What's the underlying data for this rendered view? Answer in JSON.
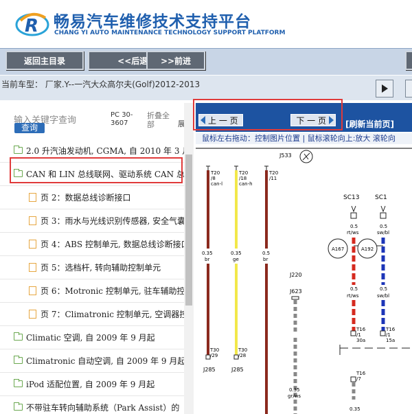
{
  "header": {
    "title_cn": "畅易汽车维修技术支持平台",
    "title_en": "CHANG YI AUTO MAINTENANCE TECHNOLOGY SUPPORT PLATFORM"
  },
  "toolbar": {
    "home_label": "返回主目录",
    "back_label": "<<后退.",
    "forward_label": ">>前进"
  },
  "car_info": "当前车型： 厂家.Y--一汽大众高尔夫(Golf)2012-2013",
  "left_panel": {
    "search_placeholder": "输入关键字查询",
    "search_button": "查询",
    "pc_label": "PC 30-",
    "pc_value": "3607",
    "fold_label_1": "折叠全",
    "fold_label_2": "部",
    "fold_label_3": "展",
    "tree": [
      {
        "type": "folder",
        "label": "2.0 升汽油发动机, CGMA, 自 2010 年 3 月"
      },
      {
        "type": "folder",
        "label": "CAN 和 LIN 总线联网、驱动系统 CAN 总线"
      },
      {
        "type": "page",
        "label": "页 2：数据总线诊断接口"
      },
      {
        "type": "page",
        "label": "页 3：雨水与光线识别传感器, 安全气囊"
      },
      {
        "type": "page",
        "label": "页 4：ABS 控制单元, 数据总线诊断接口"
      },
      {
        "type": "page",
        "label": "页 5：选档杆, 转向辅助控制单元"
      },
      {
        "type": "page",
        "label": "页 6：Motronic 控制单元, 驻车辅助控制"
      },
      {
        "type": "page",
        "label": "页 7：Climatronic 控制单元, 空调器控制"
      },
      {
        "type": "folder",
        "label": "Climatic 空调, 自 2009 年 9 月起"
      },
      {
        "type": "folder",
        "label": "Climatronic 自动空调, 自 2009 年 9 月起"
      },
      {
        "type": "folder",
        "label": "iPod 适配位置, 自 2009 年 9 月起"
      },
      {
        "type": "folder",
        "label": "不带驻车转向辅助系统（Park Assist）的"
      }
    ]
  },
  "viewer": {
    "prev_page": "上 一 页",
    "next_page": "下 一 页",
    "refresh": "[刷新当前页]",
    "hint": "鼠标左右拖动：控制图片位置 | 鼠标滚轮向上:放大  滚轮向"
  },
  "diagram": {
    "labels": {
      "j533": "J533",
      "t20_1": "T20",
      "t20_1b": "/8",
      "t20_1c": "can-l",
      "t20_2": "T20",
      "t20_2b": "/18",
      "t20_2c": "can-h",
      "t20_3": "T20",
      "t20_3b": "/11",
      "sc13": "SC13",
      "sc1": "SC1",
      "w1": "0.5",
      "w1b": "rt/ws",
      "w2": "0.5",
      "w2b": "sw/bl",
      "a167": "A167",
      "a192": "A192",
      "w3": "0.35",
      "w3b": "br",
      "w4": "0.35",
      "w4b": "ge",
      "w5": "0.5",
      "w5b": "br",
      "j220": "J220",
      "j623": "J623",
      "w6": "0.5",
      "w6b": "rt/ws",
      "w7": "0.5",
      "w7b": "sw/bl",
      "t30a": "T30",
      "t30ab": "/29",
      "t30b": "T30",
      "t30bb": "/28",
      "t16a": "T16",
      "t16ab": "/1",
      "t16ac": "30a",
      "t16b": "T16",
      "t16bb": "/1",
      "t16bc": "15a",
      "j285a": "J285",
      "j285b": "J285",
      "w8": "0.35",
      "w8b": "gr/ws",
      "t16c": "T16",
      "t16cb": "/7",
      "w9": "0.35"
    }
  },
  "colors": {
    "brand_blue": "#1f5fae",
    "viewer_bar": "#1d53a1",
    "highlight": "#e03a3a",
    "wire_brown": "#8b2a1e",
    "wire_yellow": "#f2e84a",
    "wire_red": "#d52a1f",
    "wire_blue": "#1d36b8"
  }
}
